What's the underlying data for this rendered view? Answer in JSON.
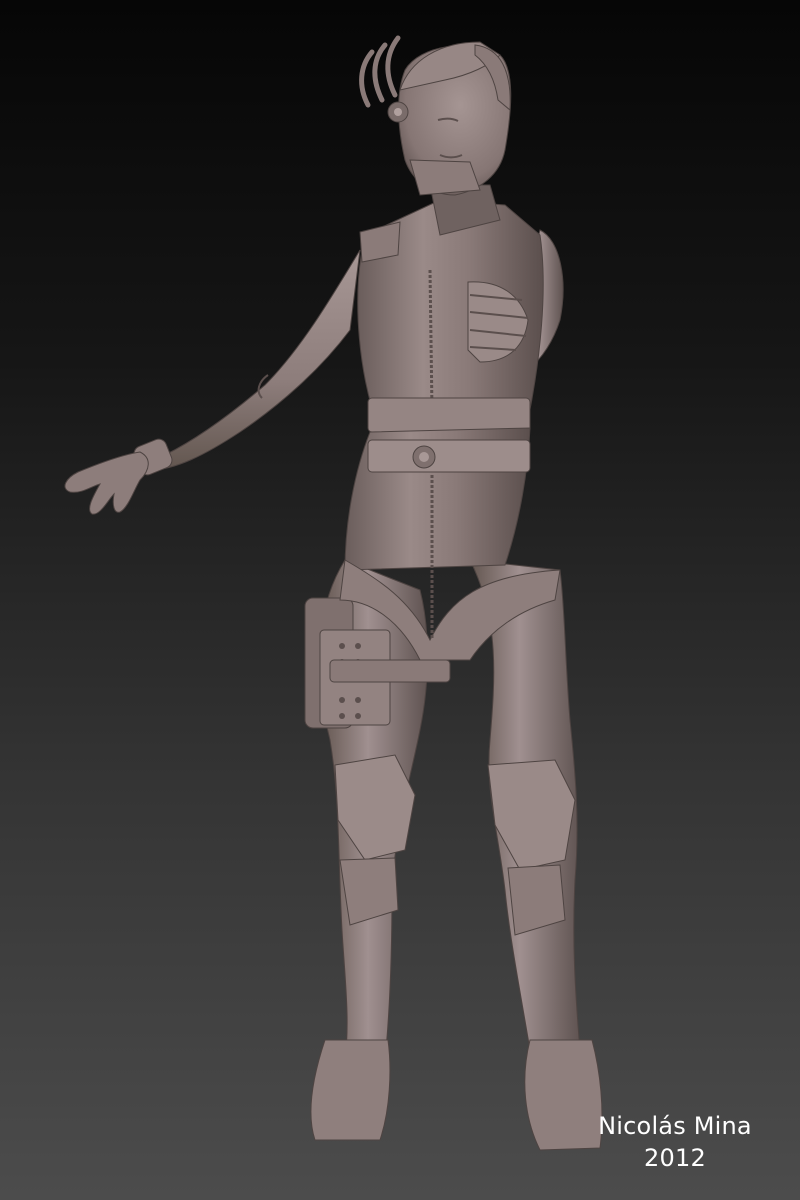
{
  "artwork": {
    "signature_name": "Nicolás Mina",
    "signature_year": "2012",
    "colors": {
      "background_top": "#060606",
      "background_bottom": "#4c4c4c",
      "clay": "#8a7a78",
      "clay_light": "#a39391",
      "clay_shadow": "#5b4f4d",
      "signature_text": "#ffffff"
    }
  }
}
